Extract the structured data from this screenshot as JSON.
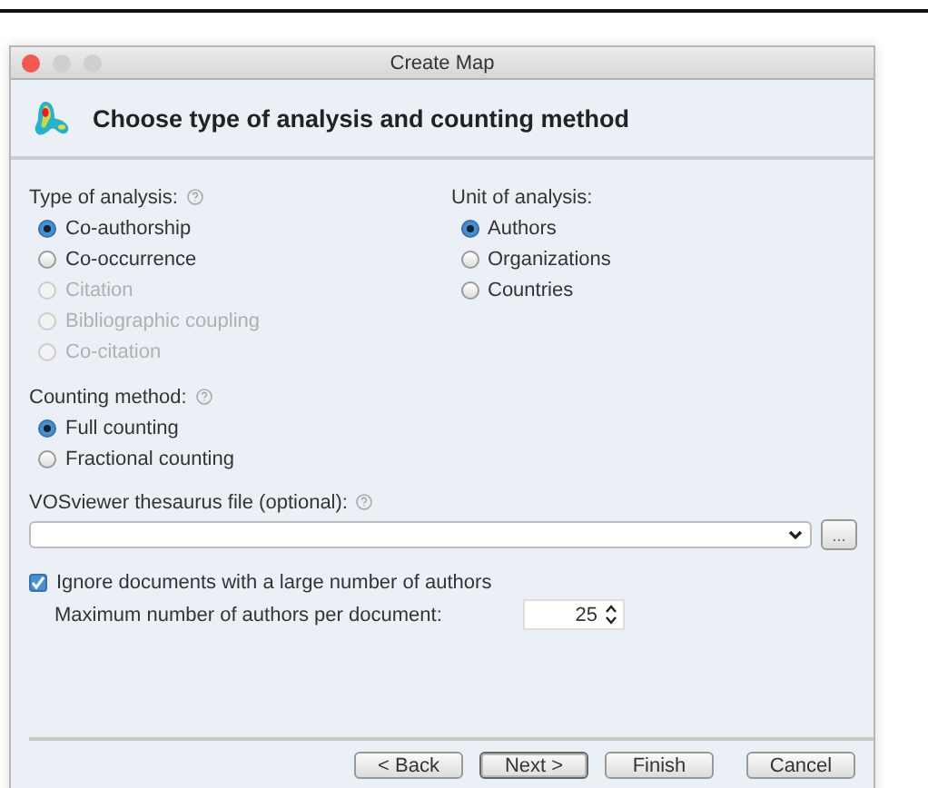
{
  "window": {
    "title": "Create Map"
  },
  "header": {
    "title": "Choose type of analysis and counting method"
  },
  "type_of_analysis": {
    "label": "Type of analysis:",
    "help": true,
    "options": [
      {
        "label": "Co-authorship",
        "selected": true,
        "disabled": false
      },
      {
        "label": "Co-occurrence",
        "selected": false,
        "disabled": false
      },
      {
        "label": "Citation",
        "selected": false,
        "disabled": true
      },
      {
        "label": "Bibliographic coupling",
        "selected": false,
        "disabled": true
      },
      {
        "label": "Co-citation",
        "selected": false,
        "disabled": true
      }
    ]
  },
  "unit_of_analysis": {
    "label": "Unit of analysis:",
    "help": false,
    "options": [
      {
        "label": "Authors",
        "selected": true,
        "disabled": false
      },
      {
        "label": "Organizations",
        "selected": false,
        "disabled": false
      },
      {
        "label": "Countries",
        "selected": false,
        "disabled": false
      }
    ]
  },
  "counting_method": {
    "label": "Counting method:",
    "help": true,
    "options": [
      {
        "label": "Full counting",
        "selected": true,
        "disabled": false
      },
      {
        "label": "Fractional counting",
        "selected": false,
        "disabled": false
      }
    ]
  },
  "thesaurus": {
    "label": "VOSviewer thesaurus file (optional):",
    "help": true,
    "browse_button": "..."
  },
  "ignore_documents": {
    "label": "Ignore documents with a large number of authors",
    "checked": true
  },
  "max_authors": {
    "label": "Maximum number of authors per document:",
    "value": "25"
  },
  "buttons": [
    {
      "label": "< Back",
      "default": false
    },
    {
      "label": "Next >",
      "default": true
    },
    {
      "label": "Finish",
      "default": false
    },
    {
      "label": "Cancel",
      "default": false
    }
  ]
}
